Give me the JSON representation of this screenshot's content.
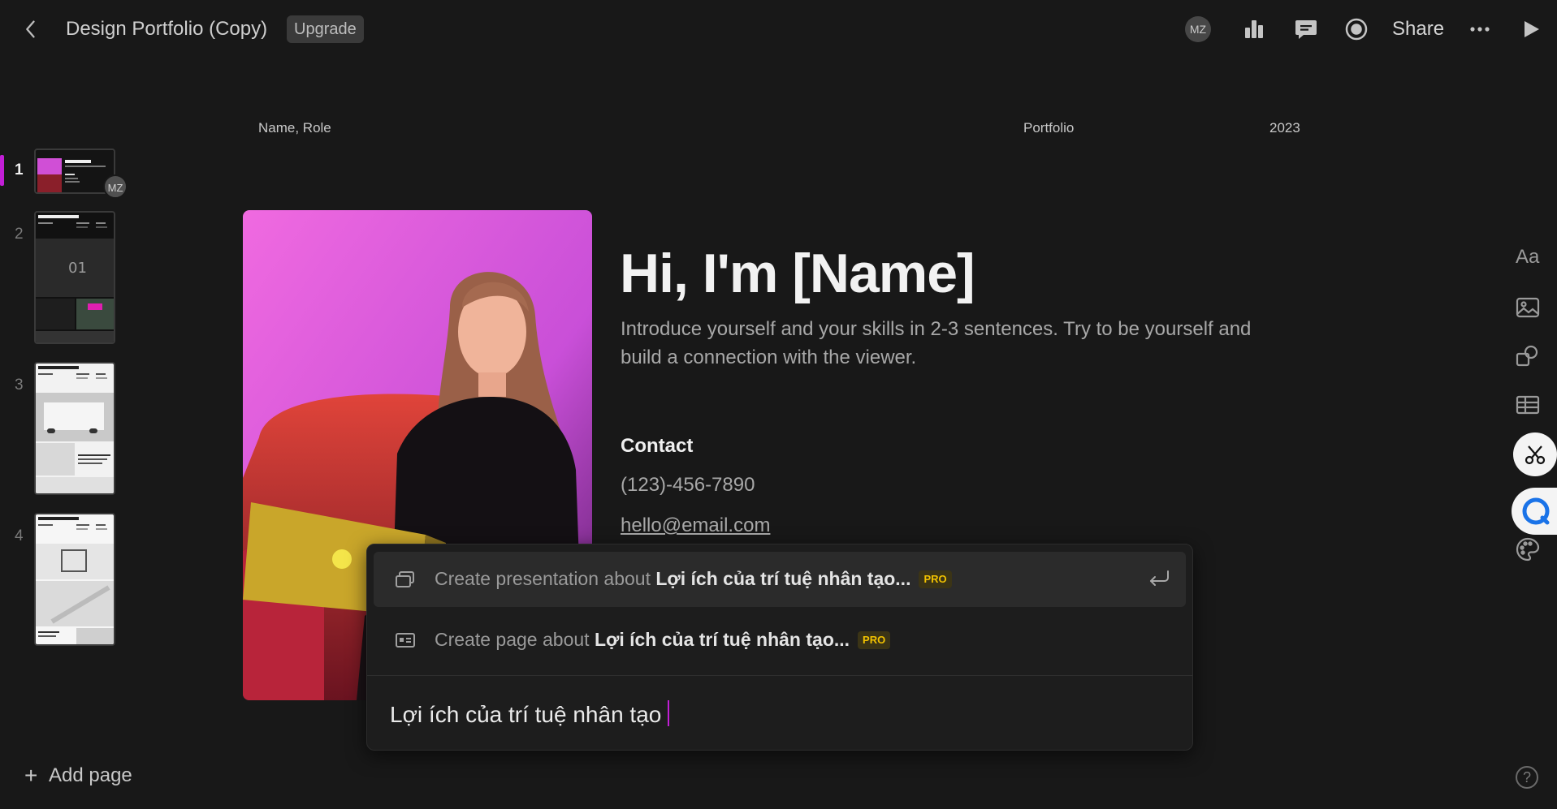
{
  "topbar": {
    "title": "Design Portfolio (Copy)",
    "upgrade_label": "Upgrade",
    "avatar_initials": "MZ",
    "share_label": "Share",
    "icons": [
      "chevron-left-icon",
      "bar-chart-icon",
      "comment-icon",
      "record-icon",
      "more-icon",
      "play-icon"
    ]
  },
  "sidebar": {
    "pages": [
      {
        "number": "1",
        "active": true
      },
      {
        "number": "2",
        "active": false
      },
      {
        "number": "3",
        "active": false
      },
      {
        "number": "4",
        "active": false
      }
    ],
    "thumb_avatar": "MZ",
    "add_page_label": "Add page"
  },
  "slide": {
    "header_left": "Name, Role",
    "header_mid": "Portfolio",
    "header_right": "2023",
    "title": "Hi, I'm [Name]",
    "description": "Introduce yourself and your skills in 2-3 sentences. Try to be yourself and build a connection with the viewer.",
    "contact_heading": "Contact",
    "phone": "(123)-456-7890",
    "email": "hello@email.com"
  },
  "ai_popup": {
    "option1_prefix": "Create presentation about ",
    "option1_topic": "Lợi ích của trí tuệ nhân tạo...",
    "option2_prefix": "Create page about ",
    "option2_topic": "Lợi ích của trí tuệ nhân tạo...",
    "pro_label": "PRO",
    "input_value": "Lợi ích của trí tuệ nhân tạo"
  },
  "right_toolbar": {
    "text_tool_label": "Aa",
    "help_label": "?"
  },
  "colors": {
    "background": "#181818",
    "accent": "#c21fd6",
    "pro_badge": "#f2c200"
  }
}
